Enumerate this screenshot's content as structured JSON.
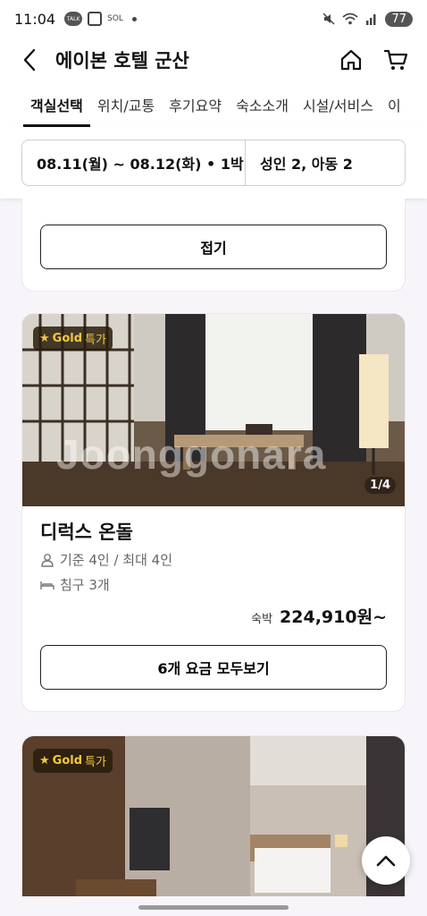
{
  "status_bar": {
    "time": "11:04",
    "battery": "77",
    "icons": [
      "talk-icon",
      "screenshot-icon",
      "sol-bank-icon",
      "dot-icon",
      "mute-icon",
      "wifi-icon",
      "signal-icon",
      "battery-icon"
    ]
  },
  "header": {
    "title": "에이본 호텔 군산",
    "icons": [
      "back-arrow-icon",
      "home-icon",
      "cart-icon"
    ]
  },
  "tabs": [
    {
      "label": "객실선택",
      "active": true
    },
    {
      "label": "위치/교통",
      "active": false
    },
    {
      "label": "후기요약",
      "active": false
    },
    {
      "label": "숙소소개",
      "active": false
    },
    {
      "label": "시설/서비스",
      "active": false
    },
    {
      "label": "이",
      "active": false
    }
  ],
  "search": {
    "date_range": "08.11(월) ~ 08.12(화) • 1박",
    "guests": "성인 2, 아동 2"
  },
  "cards": [
    {
      "collapse_label": "접기"
    },
    {
      "badge_gold": "Gold",
      "badge_special": "특가",
      "photo_counter": "1/4",
      "watermark": "Joonggonara",
      "room_name": "디럭스 온돌",
      "capacity": "기준 4인 / 최대 4인",
      "bed": "침구 3개",
      "price_label": "숙박",
      "price": "224,910원~",
      "view_rates_label": "6개 요금 모두보기"
    },
    {
      "badge_gold": "Gold",
      "badge_special": "특가"
    }
  ],
  "colors": {
    "gold": "#f3c742",
    "background": "#f7f5fa",
    "text": "#111111"
  }
}
